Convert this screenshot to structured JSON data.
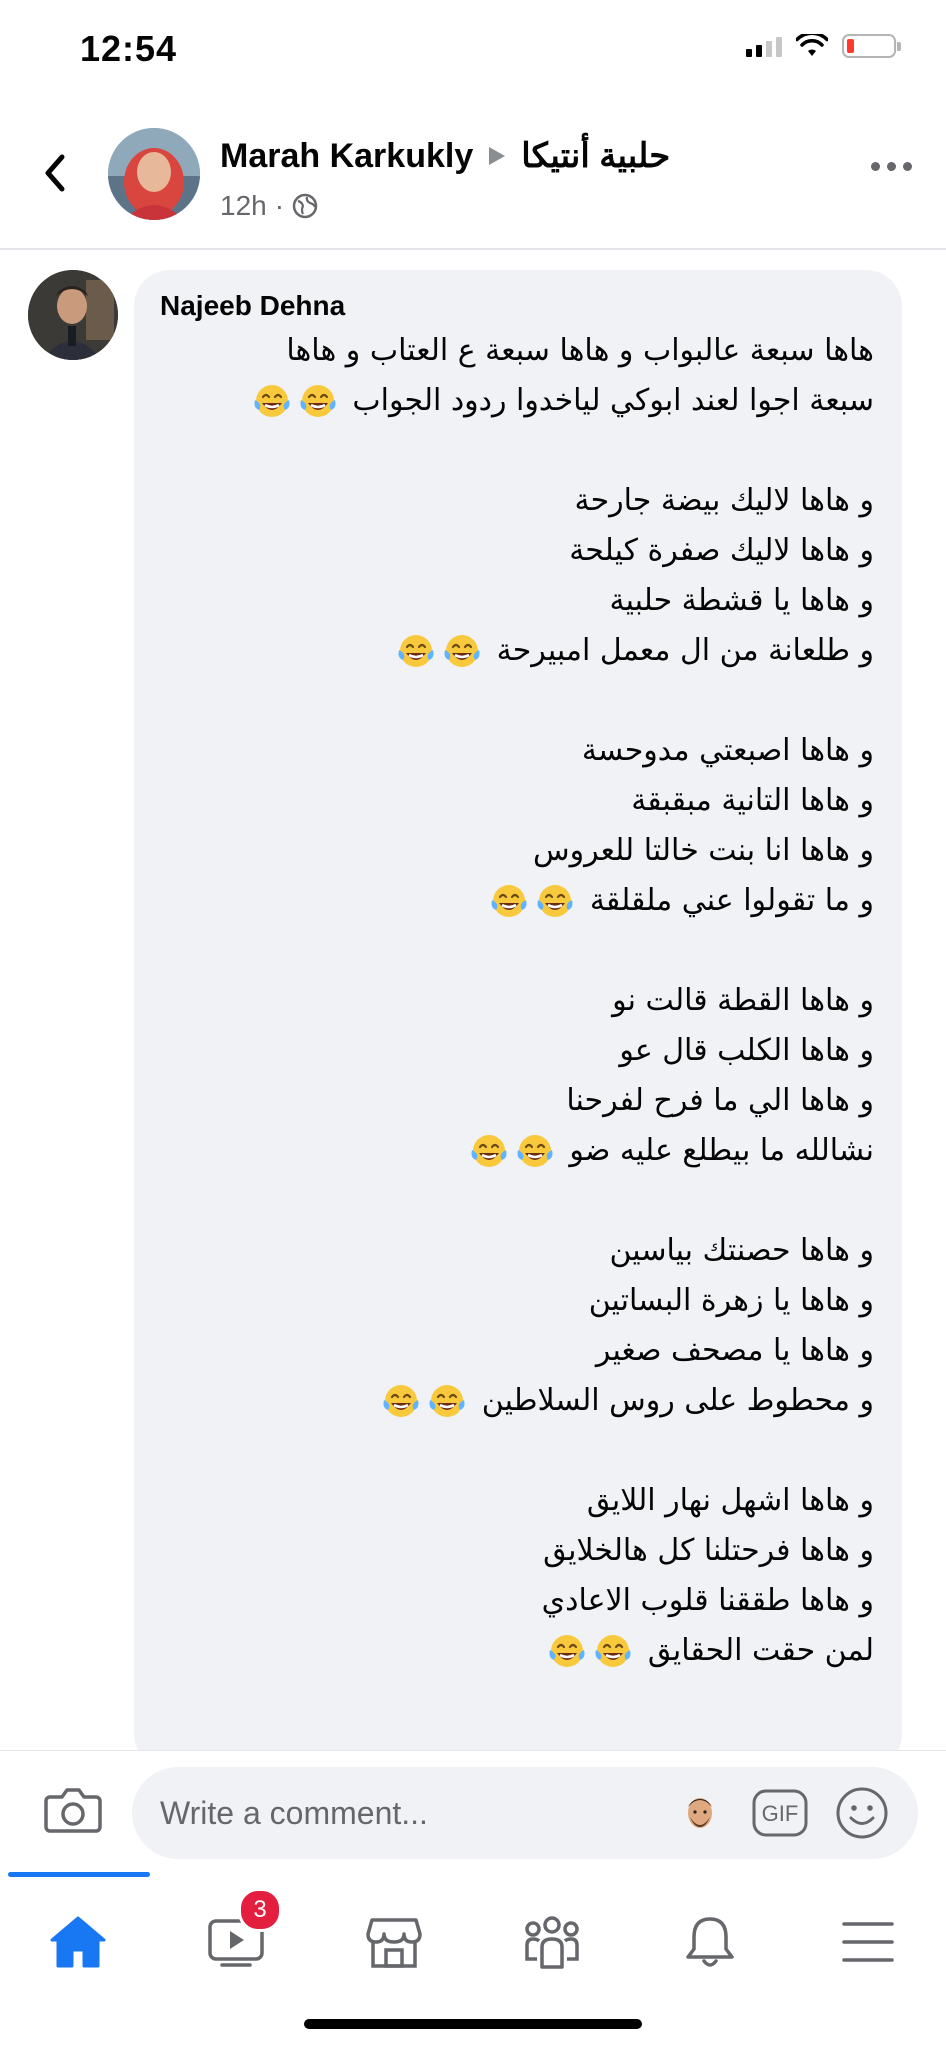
{
  "status_bar": {
    "time": "12:54",
    "icons": [
      "signal-icon",
      "wifi-icon",
      "battery-low-icon"
    ]
  },
  "post": {
    "author": "Marah Karkukly",
    "group": "حلبية أنتيكا",
    "time": "12h",
    "separator": "·",
    "privacy_icon": "globe-icon"
  },
  "comment": {
    "author": "Najeeb Dehna",
    "lines": [
      {
        "text": "هاها سبعة عالبواب و هاها سبعة ع العتاب و هاها",
        "emoji": 0
      },
      {
        "text": "سبعة اجوا لعند ابوكي لياخدوا ردود الجواب",
        "emoji": 2
      },
      {
        "text": "",
        "emoji": 0
      },
      {
        "text": "و هاها لاليك بيضة جارحة",
        "emoji": 0
      },
      {
        "text": "و هاها لاليك صفرة كيلحة",
        "emoji": 0
      },
      {
        "text": "و هاها يا قشطة حلبية",
        "emoji": 0
      },
      {
        "text": "و طلعانة من ال معمل امبيرحة",
        "emoji": 2
      },
      {
        "text": "",
        "emoji": 0
      },
      {
        "text": "و هاها اصبعتي مدوحسة",
        "emoji": 0
      },
      {
        "text": "و هاها التانية مبقبقة",
        "emoji": 0
      },
      {
        "text": "و هاها انا بنت خالتا للعروس",
        "emoji": 0
      },
      {
        "text": "و ما تقولوا عني ملقلقة",
        "emoji": 2
      },
      {
        "text": "",
        "emoji": 0
      },
      {
        "text": "و هاها القطة قالت نو",
        "emoji": 0
      },
      {
        "text": "و هاها الكلب قال عو",
        "emoji": 0
      },
      {
        "text": "و هاها الي ما فرح لفرحنا",
        "emoji": 0
      },
      {
        "text": "نشالله ما بيطلع عليه ضو",
        "emoji": 2
      },
      {
        "text": "",
        "emoji": 0
      },
      {
        "text": "و هاها حصنتك بياسين",
        "emoji": 0
      },
      {
        "text": "و هاها يا زهرة البساتين",
        "emoji": 0
      },
      {
        "text": "و هاها يا مصحف صغير",
        "emoji": 0
      },
      {
        "text": "و محطوط على روس السلاطين",
        "emoji": 2
      },
      {
        "text": "",
        "emoji": 0
      },
      {
        "text": "و هاها اشهل نهار اللايق",
        "emoji": 0
      },
      {
        "text": "و هاها فرحتلنا كل هالخلايق",
        "emoji": 0
      },
      {
        "text": "و هاها طققنا قلوب الاعادي",
        "emoji": 0
      },
      {
        "text": "لمن حقت الحقايق",
        "emoji": 2
      }
    ],
    "emoji_name": "face-with-tears-of-joy-emoji"
  },
  "composer": {
    "placeholder": "Write a comment...",
    "gif_label": "GIF"
  },
  "tabs": [
    {
      "name": "home",
      "icon": "home-icon",
      "active": true
    },
    {
      "name": "watch",
      "icon": "video-icon",
      "badge": "3"
    },
    {
      "name": "marketplace",
      "icon": "store-icon"
    },
    {
      "name": "groups",
      "icon": "groups-icon"
    },
    {
      "name": "notifications",
      "icon": "bell-icon"
    },
    {
      "name": "menu",
      "icon": "hamburger-icon"
    }
  ],
  "colors": {
    "accent": "#1877f2",
    "bubble": "#f0f2f5",
    "secondary_text": "#65676b",
    "badge": "#e41e3f"
  }
}
